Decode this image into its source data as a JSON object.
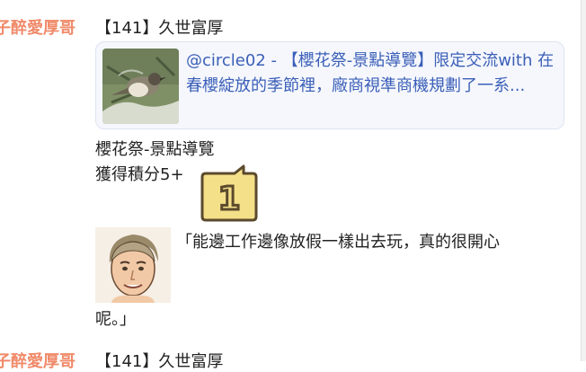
{
  "posts": [
    {
      "author": "子醉愛厚哥",
      "title": "【141】久世富厚",
      "link_card": {
        "text": "@circle02 - 【櫻花祭-景點導覽】限定交流with 在春櫻綻放的季節裡，廠商視準商機規劃了一系..."
      },
      "body_lines": [
        "櫻花祭-景點導覽",
        "獲得積分5+"
      ],
      "badge_number": "1",
      "quote_start": "「能邊工作邊像放假一樣出去玩，真的很開心",
      "quote_end": "呢。」"
    },
    {
      "author": "子醉愛厚哥",
      "title": "【141】久世富厚"
    }
  ],
  "colors": {
    "author": "#f08a6a",
    "link_text": "#3b5fb8",
    "card_bg": "#f5f7fc",
    "badge_fill": "#f5e08a"
  }
}
